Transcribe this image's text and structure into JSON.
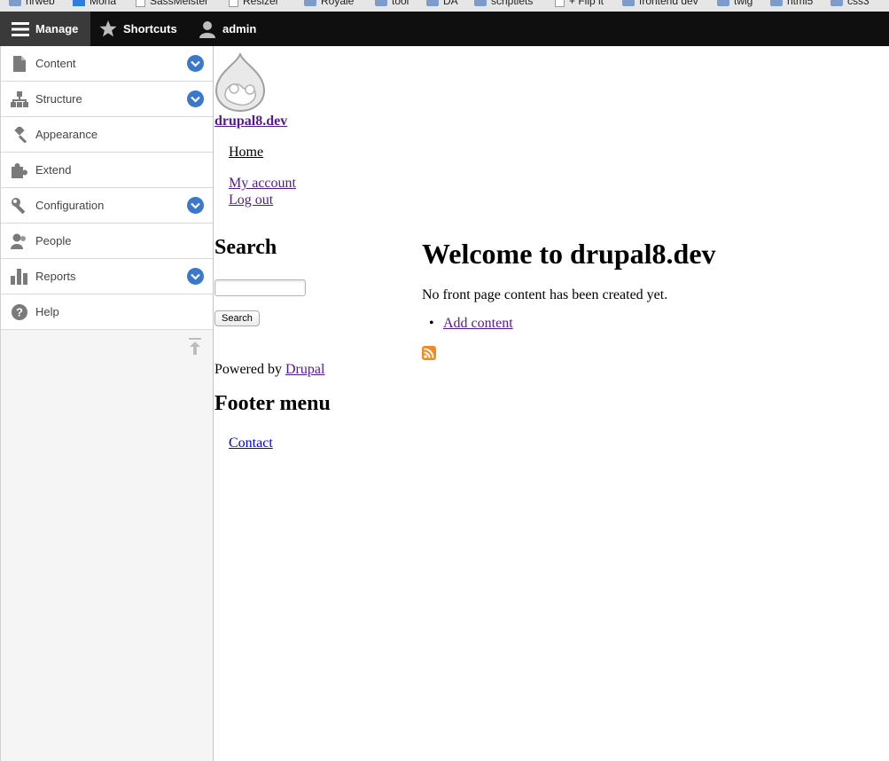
{
  "bookmarks": [
    {
      "label": "nrweb",
      "type": "folder"
    },
    {
      "label": "Mona",
      "type": "blue"
    },
    {
      "label": "SassMeister",
      "type": "page"
    },
    {
      "label": "Resizer",
      "type": "page"
    },
    {
      "label": "Royale",
      "type": "folder"
    },
    {
      "label": "tool",
      "type": "folder"
    },
    {
      "label": "DA",
      "type": "folder"
    },
    {
      "label": "scriptlets",
      "type": "folder"
    },
    {
      "label": "+ Flip it",
      "type": "page"
    },
    {
      "label": "frontend dev",
      "type": "folder"
    },
    {
      "label": "twig",
      "type": "folder"
    },
    {
      "label": "html5",
      "type": "folder"
    },
    {
      "label": "css3",
      "type": "folder"
    }
  ],
  "toolbar": {
    "manage": "Manage",
    "shortcuts": "Shortcuts",
    "user": "admin"
  },
  "tray": {
    "items": [
      {
        "label": "Content",
        "icon": "document-icon",
        "expandable": true
      },
      {
        "label": "Structure",
        "icon": "hierarchy-icon",
        "expandable": true
      },
      {
        "label": "Appearance",
        "icon": "brush-icon",
        "expandable": false
      },
      {
        "label": "Extend",
        "icon": "puzzle-icon",
        "expandable": false
      },
      {
        "label": "Configuration",
        "icon": "wrench-icon",
        "expandable": true
      },
      {
        "label": "People",
        "icon": "people-icon",
        "expandable": false
      },
      {
        "label": "Reports",
        "icon": "bar-chart-icon",
        "expandable": true
      },
      {
        "label": "Help",
        "icon": "help-icon",
        "expandable": false
      }
    ]
  },
  "site": {
    "name": "drupal8.dev",
    "nav": {
      "home": "Home",
      "account": "My account",
      "logout": "Log out"
    },
    "search_title": "Search",
    "search_button": "Search",
    "powered_by": "Powered by ",
    "powered_link": "Drupal",
    "footer_title": "Footer menu",
    "footer_link": "Contact"
  },
  "main": {
    "title": "Welcome to drupal8.dev",
    "message": "No front page content has been created yet.",
    "add_content": "Add content"
  },
  "colors": {
    "toolbar_bg": "#0f0f0f",
    "chevron_blue": "#3b78cc",
    "visited_link": "#551a8b",
    "link": "#0000ee",
    "rss": "#f28a1d"
  }
}
